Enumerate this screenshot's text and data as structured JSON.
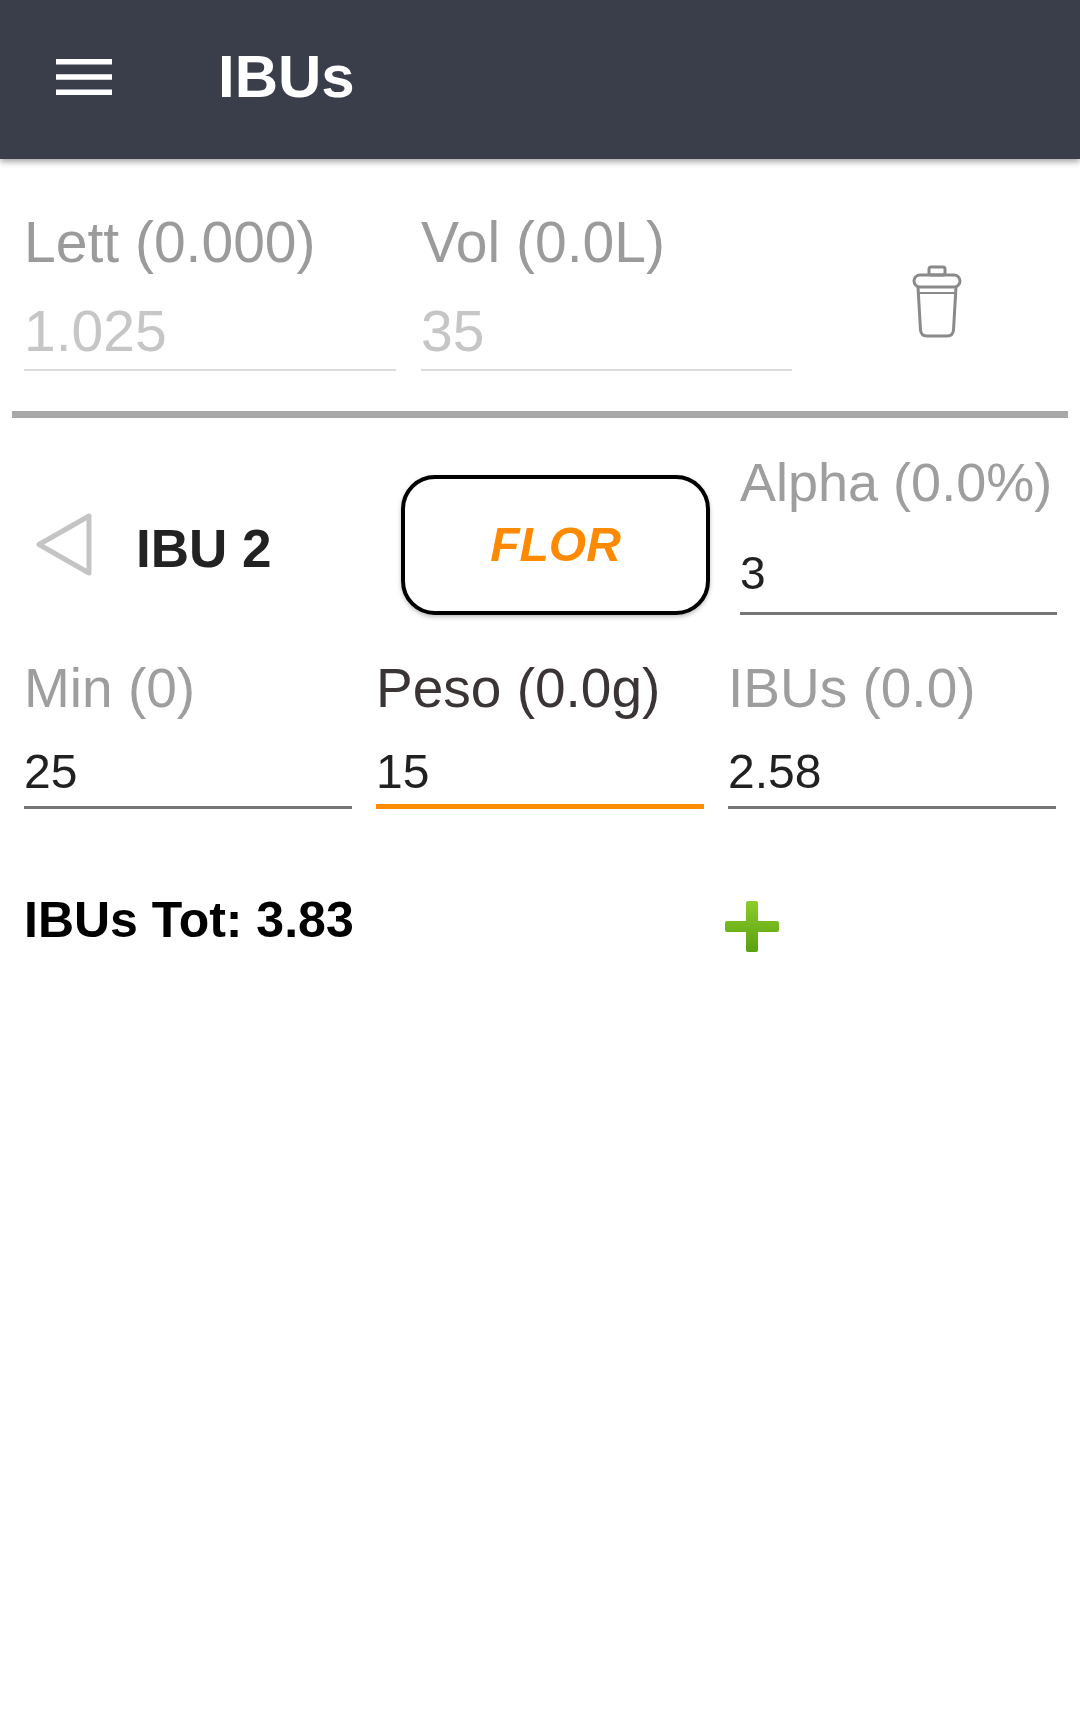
{
  "app_bar": {
    "title": "IBUs"
  },
  "wort": {
    "fields": [
      {
        "label": "Lett (0.000)",
        "value": "1.025",
        "disabled": true
      },
      {
        "label": "Vol (0.0L)",
        "value": "35",
        "disabled": true
      }
    ]
  },
  "hop": {
    "title": "IBU 2",
    "type_button": {
      "label": "FLOR"
    },
    "alpha": {
      "label": "Alpha (0.0%)",
      "value": "3"
    },
    "fields": [
      {
        "label": "Min (0)",
        "value": "25",
        "focused": false
      },
      {
        "label": "Peso (0.0g)",
        "value": "15",
        "focused": true
      },
      {
        "label": "IBUs (0.0)",
        "value": "2.58",
        "focused": false
      }
    ]
  },
  "total": {
    "text": "IBUs Tot: 3.83"
  }
}
